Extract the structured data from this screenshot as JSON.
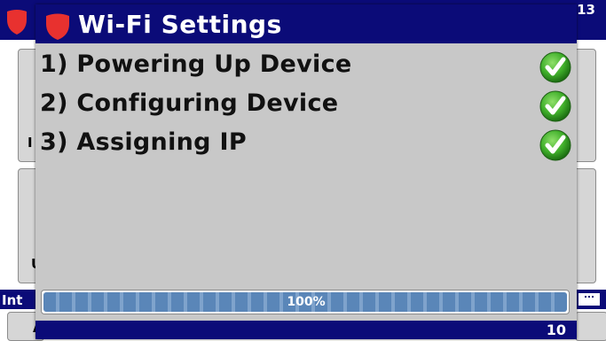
{
  "background": {
    "corner_number": "13",
    "status_label": "Int",
    "left_card_glyph": "I",
    "left_card_glyph_2": "U",
    "bottom_card_glyph": "A",
    "header_color": "#0b0b78"
  },
  "dialog": {
    "title": "Wi-Fi Settings",
    "title_icon": "shield-icon",
    "steps": [
      {
        "label": "1) Powering Up Device",
        "status": "complete",
        "icon": "check-icon"
      },
      {
        "label": "2) Configuring Device",
        "status": "complete",
        "icon": "check-icon"
      },
      {
        "label": "3) Assigning IP",
        "status": "complete",
        "icon": "check-icon"
      }
    ],
    "progress": {
      "value": 1.0,
      "label": "100%"
    },
    "footer_number": "10"
  },
  "colors": {
    "title_bar": "#0b0b78",
    "dialog_body": "#c8c8c8",
    "progress_fill": "#5a86b8",
    "check_green": "#3fae2a",
    "shield_red": "#e8312f"
  }
}
